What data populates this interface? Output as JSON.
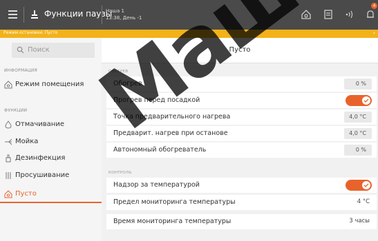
{
  "topbar": {
    "title": "Функции паузы",
    "room_line1": "Наша 1",
    "room_line2": "13:38, День -1",
    "badge_count": "4",
    "icons": [
      "hamburger-icon",
      "program-icon",
      "home-icon",
      "recipe-icon",
      "wireless-icon",
      "bell-icon"
    ]
  },
  "status": {
    "text": "Режим остановки: Пусто",
    "arrow": "›"
  },
  "sidebar": {
    "search_placeholder": "Поиск",
    "info_caption": "ИНФОРМАЦИЯ",
    "room_mode": "Режим помещения",
    "functions_caption": "ФУНКЦИИ",
    "items": [
      {
        "label": "Отмачивание",
        "icon": "soak-icon"
      },
      {
        "label": "Мойка",
        "icon": "wash-icon"
      },
      {
        "label": "Дезинфекция",
        "icon": "disinfect-icon"
      },
      {
        "label": "Просушивание",
        "icon": "drying-icon"
      },
      {
        "label": "Пусто",
        "icon": "empty-icon",
        "active": true
      }
    ]
  },
  "main": {
    "title": "Пусто",
    "heating_caption": "ОБОГРЕВ",
    "heating_rows": [
      {
        "label": "Обогрев",
        "value": "0 %"
      },
      {
        "label": "Прогрев перед посадкой",
        "toggle": true
      },
      {
        "label": "Точка предварительного нагрева",
        "value": "4,0 °C"
      },
      {
        "label": "Предварит. нагрев при останове",
        "value": "4,0 °C"
      },
      {
        "label": "Автономный обогреватель",
        "value": "0 %"
      }
    ],
    "control_caption": "КОНТРОЛЬ",
    "control_rows": [
      {
        "label": "Надзор за температурой",
        "toggle": true
      },
      {
        "label": "Предел мониторинга температуры",
        "value": "4 °C"
      },
      {
        "label": "Время мониторинга температуры",
        "value": "3 часы"
      }
    ]
  },
  "watermark": "Машин",
  "colors": {
    "accent": "#e8632b",
    "status": "#f3b21a",
    "topbar": "#4a4a4a"
  }
}
